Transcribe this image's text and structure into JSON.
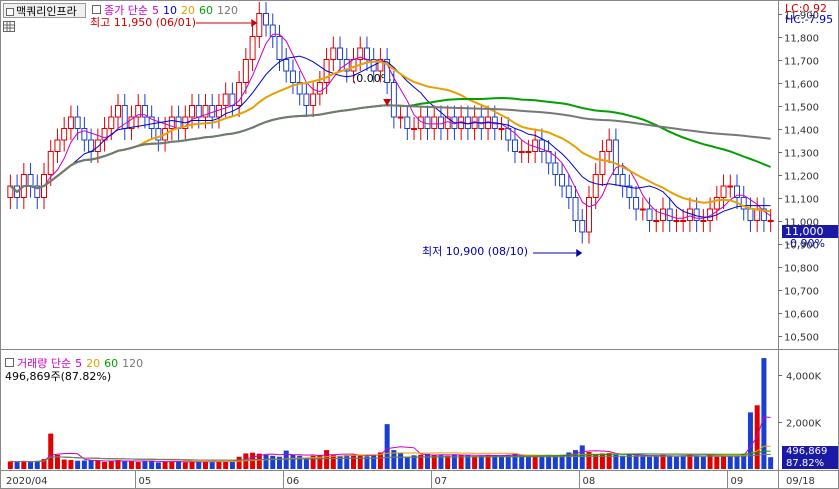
{
  "header": {
    "stock_name": "맥쿼리인프라",
    "legend_price_label": "종가 단순",
    "ma_periods": [
      "5",
      "10",
      "20",
      "60",
      "120"
    ],
    "ma_colors": [
      "#cc00cc",
      "#0000cc",
      "#e8a000",
      "#00a000",
      "#777777"
    ],
    "lc_label": "LC:0.92",
    "hc_label": "HC:-7.95",
    "high_annotation": "최고 11,950 (06/01)",
    "low_annotation": "최저 10,900 (08/10)",
    "cursor_annotation": "(0.00%)",
    "last_price": "11,000",
    "last_change": "-0.90%"
  },
  "volume_panel": {
    "legend_label": "거래량 단순",
    "ma_periods": [
      "5",
      "20",
      "60",
      "120"
    ],
    "last_volume_text": "496,869주(87.82%)",
    "last_volume_value": "496,869",
    "last_volume_pct": "87.82%"
  },
  "chart_data": [
    {
      "type": "candlestick",
      "y_ticks": [
        "11,900",
        "11,800",
        "11,700",
        "11,600",
        "11,500",
        "11,400",
        "11,300",
        "11,200",
        "11,100",
        "11,000",
        "10,900",
        "10,800",
        "10,700",
        "10,600",
        "10,500"
      ],
      "y_values": [
        11900,
        11800,
        11700,
        11600,
        11500,
        11400,
        11300,
        11200,
        11100,
        11000,
        10900,
        10800,
        10700,
        10600,
        10500
      ],
      "ylim": [
        10450,
        11950
      ],
      "x_ticks": [
        "2020/04",
        "05",
        "06",
        "07",
        "08",
        "09",
        "09/18"
      ],
      "high": {
        "value": 11950,
        "date": "06/01"
      },
      "low": {
        "value": 10900,
        "date": "08/10"
      },
      "last": 11000,
      "close_series": [
        11150,
        11100,
        11200,
        11150,
        11100,
        11200,
        11300,
        11350,
        11400,
        11450,
        11400,
        11350,
        11300,
        11350,
        11400,
        11450,
        11500,
        11400,
        11450,
        11500,
        11450,
        11400,
        11350,
        11400,
        11450,
        11400,
        11450,
        11500,
        11450,
        11500,
        11450,
        11500,
        11550,
        11500,
        11600,
        11700,
        11800,
        11900,
        11850,
        11800,
        11700,
        11650,
        11600,
        11550,
        11500,
        11550,
        11600,
        11700,
        11750,
        11700,
        11650,
        11700,
        11750,
        11700,
        11650,
        11700,
        11600,
        11450,
        11450,
        11400,
        11400,
        11450,
        11400,
        11450,
        11400,
        11450,
        11400,
        11450,
        11400,
        11450,
        11400,
        11450,
        11400,
        11400,
        11350,
        11300,
        11300,
        11300,
        11350,
        11300,
        11250,
        11200,
        11150,
        11100,
        11000,
        10950,
        11100,
        11200,
        11300,
        11350,
        11200,
        11150,
        11100,
        11050,
        11050,
        11000,
        11000,
        11050,
        11000,
        11000,
        11000,
        11050,
        11000,
        11000,
        11050,
        11100,
        11150,
        11150,
        11100,
        11050,
        11000,
        11050,
        11000,
        11000
      ],
      "ma_series": [
        {
          "name": "5",
          "color": "#cc00cc"
        },
        {
          "name": "10",
          "color": "#0000cc"
        },
        {
          "name": "20",
          "color": "#e8a000"
        },
        {
          "name": "60",
          "color": "#00a000"
        },
        {
          "name": "120",
          "color": "#777777"
        }
      ]
    },
    {
      "type": "bar",
      "y_ticks": [
        "4,000K",
        "2,000K"
      ],
      "y_values": [
        4000,
        2000
      ],
      "ylim": [
        0,
        5000
      ],
      "volumes_k": [
        320,
        310,
        330,
        300,
        340,
        420,
        1500,
        600,
        400,
        380,
        350,
        360,
        370,
        340,
        300,
        320,
        380,
        360,
        340,
        300,
        320,
        360,
        280,
        300,
        310,
        330,
        280,
        300,
        320,
        340,
        290,
        300,
        330,
        310,
        520,
        660,
        690,
        650,
        600,
        560,
        520,
        780,
        600,
        560,
        480,
        560,
        600,
        800,
        600,
        560,
        590,
        600,
        580,
        540,
        600,
        700,
        1900,
        800,
        700,
        520,
        580,
        600,
        640,
        600,
        580,
        560,
        620,
        600,
        580,
        540,
        560,
        600,
        580,
        560,
        600,
        640,
        560,
        520,
        560,
        580,
        600,
        560,
        600,
        700,
        800,
        1000,
        720,
        640,
        660,
        680,
        600,
        560,
        620,
        580,
        560,
        520,
        560,
        600,
        560,
        520,
        560,
        600,
        560,
        520,
        600,
        520,
        540,
        560,
        580,
        640,
        2400,
        2700,
        4700,
        500
      ],
      "up_flags": [
        1,
        0,
        1,
        0,
        0,
        1,
        1,
        1,
        1,
        1,
        0,
        0,
        0,
        1,
        1,
        1,
        1,
        0,
        1,
        1,
        0,
        0,
        0,
        1,
        1,
        0,
        1,
        1,
        0,
        1,
        0,
        1,
        1,
        0,
        1,
        1,
        1,
        1,
        0,
        0,
        0,
        0,
        0,
        0,
        0,
        1,
        1,
        1,
        1,
        0,
        0,
        1,
        1,
        0,
        0,
        1,
        0,
        0,
        0,
        0,
        0,
        1,
        0,
        1,
        0,
        1,
        0,
        1,
        0,
        1,
        0,
        1,
        0,
        0,
        0,
        0,
        0,
        0,
        1,
        0,
        0,
        0,
        0,
        0,
        0,
        0,
        1,
        1,
        1,
        1,
        0,
        0,
        0,
        0,
        0,
        0,
        0,
        1,
        0,
        0,
        0,
        1,
        0,
        0,
        1,
        1,
        1,
        0,
        0,
        0,
        0,
        1,
        0,
        0
      ]
    }
  ]
}
